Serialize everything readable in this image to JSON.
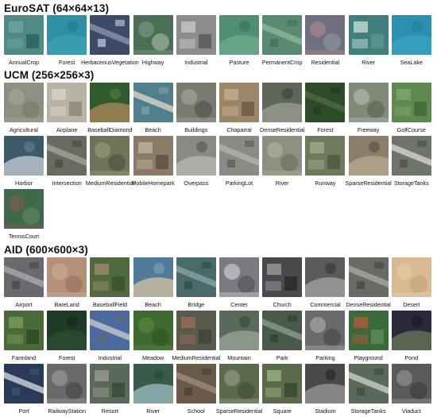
{
  "sections": [
    {
      "title": "EuroSAT (64×64×13)",
      "items": [
        {
          "label": "AnnualCrop",
          "colors": [
            "#4f8a86",
            "#6fa3a0",
            "#2f5f62"
          ]
        },
        {
          "label": "Forest",
          "colors": [
            "#2f8fa5",
            "#3fa0b5",
            "#247a8f"
          ]
        },
        {
          "label": "HerbaceousVegetation",
          "colors": [
            "#3d4a68",
            "#8a93a8",
            "#c9cfdb"
          ]
        },
        {
          "label": "Highway",
          "colors": [
            "#4b6f55",
            "#7e9b86",
            "#a9bcae"
          ]
        },
        {
          "label": "Industrial",
          "colors": [
            "#8c8c8c",
            "#c5c5c5",
            "#5b5b5b"
          ]
        },
        {
          "label": "Pasture",
          "colors": [
            "#4f8f73",
            "#6fa98c",
            "#3a7560"
          ]
        },
        {
          "label": "PermanentCrop",
          "colors": [
            "#5a8a72",
            "#8eb39c",
            "#3f6d59"
          ]
        },
        {
          "label": "Residential",
          "colors": [
            "#6f6f7f",
            "#b08a8a",
            "#8f9aa5"
          ]
        },
        {
          "label": "River",
          "colors": [
            "#3f7f7d",
            "#c8d8d6",
            "#5d938c"
          ]
        },
        {
          "label": "SeaLake",
          "colors": [
            "#2b8fb0",
            "#3ba3c2",
            "#2580a0"
          ]
        }
      ]
    },
    {
      "title": "UCM (256×256×3)",
      "items": [
        {
          "label": "Agricultural",
          "colors": [
            "#8e8e82",
            "#a5a597",
            "#777769"
          ]
        },
        {
          "label": "Airplane",
          "colors": [
            "#b9b3a6",
            "#d7d2c8",
            "#8d8778"
          ]
        },
        {
          "label": "BaseballDiamond",
          "colors": [
            "#2f5a2e",
            "#b08a5a",
            "#4f7a3e"
          ]
        },
        {
          "label": "Beach",
          "colors": [
            "#4f7f8c",
            "#d9d3c3",
            "#7fa2a8"
          ]
        },
        {
          "label": "Buildings",
          "colors": [
            "#7a7a70",
            "#a8a89d",
            "#4e4e46"
          ]
        },
        {
          "label": "Chaparral",
          "colors": [
            "#9d8667",
            "#c3ad8c",
            "#6e5a40"
          ]
        },
        {
          "label": "DenseResidential",
          "colors": [
            "#5e665a",
            "#9aa093",
            "#3f463c"
          ]
        },
        {
          "label": "Forest",
          "colors": [
            "#2e4a2a",
            "#4a6a40",
            "#223a20"
          ]
        },
        {
          "label": "Freeway",
          "colors": [
            "#7f8a78",
            "#b9bfb3",
            "#56624f"
          ]
        },
        {
          "label": "GolfCourse",
          "colors": [
            "#5f8a4f",
            "#7fa56a",
            "#3e6a36"
          ]
        },
        {
          "label": "Harbor",
          "colors": [
            "#3d5a6a",
            "#c9d0d5",
            "#5f7a87"
          ]
        },
        {
          "label": "Intersection",
          "colors": [
            "#6a6a60",
            "#a3a398",
            "#494940"
          ]
        },
        {
          "label": "MediumResidential",
          "colors": [
            "#6f7358",
            "#a09a80",
            "#4c5040"
          ]
        },
        {
          "label": "MobileHomepark",
          "colors": [
            "#8a7a68",
            "#c0b29e",
            "#5f5242"
          ]
        },
        {
          "label": "Overpass",
          "colors": [
            "#8a8a84",
            "#b8b8b0",
            "#5c5c56"
          ]
        },
        {
          "label": "ParkingLot",
          "colors": [
            "#8a8a86",
            "#b3b1ab",
            "#5a5956"
          ]
        },
        {
          "label": "River",
          "colors": [
            "#8d907f",
            "#b0b2a2",
            "#6a6d5c"
          ]
        },
        {
          "label": "Runway",
          "colors": [
            "#6f7a5a",
            "#a2a890",
            "#4f5a3f"
          ]
        },
        {
          "label": "SparseResidential",
          "colors": [
            "#8a7f6a",
            "#b7a98f",
            "#5f5645"
          ]
        },
        {
          "label": "StorageTanks",
          "colors": [
            "#6f7468",
            "#d3d3cf",
            "#4a4e44"
          ]
        },
        {
          "label": "TennisCourt",
          "colors": [
            "#3e6a4a",
            "#8a5a4a",
            "#5f8a62"
          ]
        }
      ]
    },
    {
      "title": "AID (600×600×3)",
      "items": [
        {
          "label": "Airport",
          "colors": [
            "#6a6a6e",
            "#a9a9ad",
            "#45454a"
          ]
        },
        {
          "label": "BareLand",
          "colors": [
            "#b58f78",
            "#cfae98",
            "#966f5a"
          ]
        },
        {
          "label": "BaseballField",
          "colors": [
            "#4f6a3e",
            "#9a8a6a",
            "#3a522e"
          ]
        },
        {
          "label": "Beach",
          "colors": [
            "#4f7a9a",
            "#d8c3a0",
            "#7aa0b5"
          ]
        },
        {
          "label": "Bridge",
          "colors": [
            "#4a6a6a",
            "#8aa0a0",
            "#2f4a4a"
          ]
        },
        {
          "label": "Center",
          "colors": [
            "#7a7a80",
            "#d8d8dc",
            "#505058"
          ]
        },
        {
          "label": "Church",
          "colors": [
            "#4a4a4e",
            "#9a9a9e",
            "#2a2a2e"
          ]
        },
        {
          "label": "Commercial",
          "colors": [
            "#5a5a5a",
            "#a5a5a5",
            "#3a3a3a"
          ]
        },
        {
          "label": "DenseResidential",
          "colors": [
            "#6a6a64",
            "#a8a89e",
            "#454540"
          ]
        },
        {
          "label": "Desert",
          "colors": [
            "#d8b992",
            "#e6cda9",
            "#c2a27a"
          ]
        },
        {
          "label": "Farmland",
          "colors": [
            "#4a6a3a",
            "#7a9a5a",
            "#2f4a26"
          ]
        },
        {
          "label": "Forest",
          "colors": [
            "#1f3a26",
            "#2e4e34",
            "#15291b"
          ]
        },
        {
          "label": "Industrial",
          "colors": [
            "#4a6aa0",
            "#c8c8c8",
            "#6a6a6a"
          ]
        },
        {
          "label": "Meadow",
          "colors": [
            "#3f6a2f",
            "#5a8a42",
            "#2f5222"
          ]
        },
        {
          "label": "MediumResidential",
          "colors": [
            "#5a5a4a",
            "#9a6a5a",
            "#3f453a"
          ]
        },
        {
          "label": "Mountain",
          "colors": [
            "#5a6a5a",
            "#9aa59a",
            "#3a4a3a"
          ]
        },
        {
          "label": "Park",
          "colors": [
            "#4a5a4a",
            "#8a9a8a",
            "#2e3e2e"
          ]
        },
        {
          "label": "Parking",
          "colors": [
            "#6a6a6a",
            "#b0b0b0",
            "#444444"
          ]
        },
        {
          "label": "Playground",
          "colors": [
            "#3a6a3a",
            "#b05a3a",
            "#5a8a5a"
          ]
        },
        {
          "label": "Pond",
          "colors": [
            "#2a2a3a",
            "#6a7a5a",
            "#1a1a2a"
          ]
        },
        {
          "label": "Port",
          "colors": [
            "#2a3a5a",
            "#d0d4dc",
            "#3f5270"
          ]
        },
        {
          "label": "RailwayStation",
          "colors": [
            "#6a6a6a",
            "#a0a0a0",
            "#454545"
          ]
        },
        {
          "label": "Resort",
          "colors": [
            "#5a6a5a",
            "#9a9a8a",
            "#3a4a3a"
          ]
        },
        {
          "label": "River",
          "colors": [
            "#3a5a4a",
            "#a0c0c5",
            "#2a4a3a"
          ]
        },
        {
          "label": "School",
          "colors": [
            "#6a5a4a",
            "#a08a7a",
            "#4a3f35"
          ]
        },
        {
          "label": "SparseResidential",
          "colors": [
            "#5a6a4a",
            "#9aa08a",
            "#3f4a35"
          ]
        },
        {
          "label": "Square",
          "colors": [
            "#5a6a4a",
            "#9ab07a",
            "#3a4a2e"
          ]
        },
        {
          "label": "Stadium",
          "colors": [
            "#4a4a4a",
            "#9a9a9a",
            "#2a2a2a"
          ]
        },
        {
          "label": "StorageTanks",
          "colors": [
            "#5a6a5a",
            "#c8ccc8",
            "#3a4a3a"
          ]
        },
        {
          "label": "Viaduct",
          "colors": [
            "#5a5a5a",
            "#9a9a9a",
            "#3a3a3a"
          ]
        }
      ]
    }
  ]
}
